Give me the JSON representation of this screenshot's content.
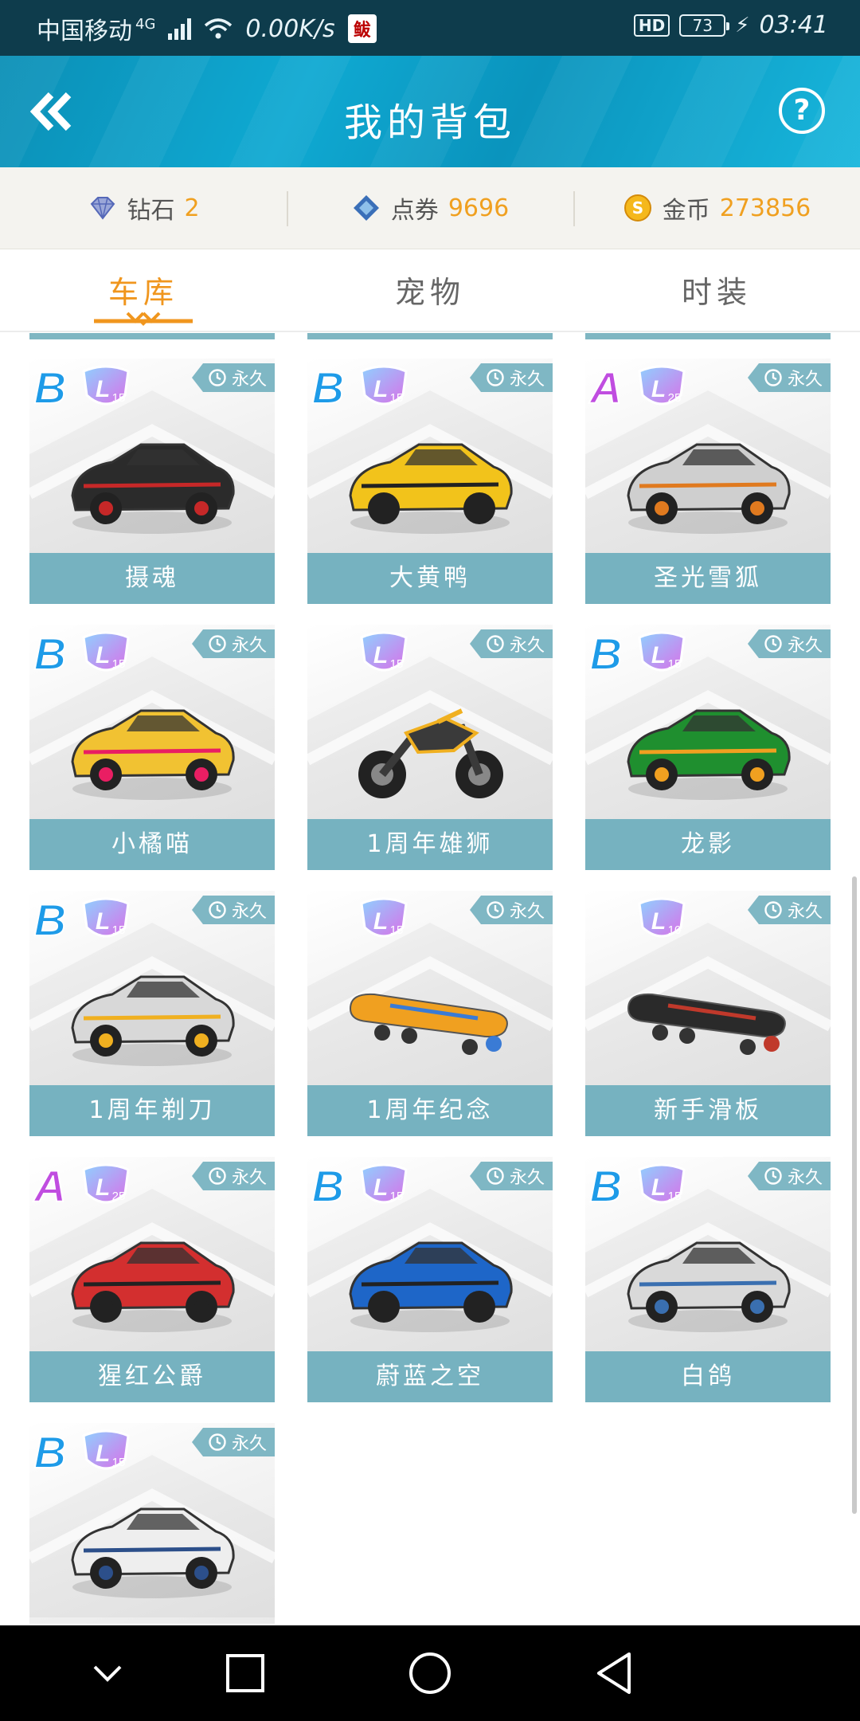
{
  "status_bar": {
    "carrier": "中国移动",
    "network": "4G",
    "speed": "0.00K/s",
    "hd": "HD",
    "battery": "73",
    "time": "03:41",
    "app_icon_text": "鲅"
  },
  "header": {
    "title": "我的背包",
    "back_icon": "double-chevron-left-icon",
    "help_icon": "?"
  },
  "currency": [
    {
      "label": "钻石",
      "value": "2",
      "icon": "diamond-icon"
    },
    {
      "label": "点券",
      "value": "9696",
      "icon": "voucher-icon"
    },
    {
      "label": "金币",
      "value": "273856",
      "icon": "coin-icon"
    }
  ],
  "tabs": [
    {
      "label": "车库",
      "active": true
    },
    {
      "label": "宠物",
      "active": false
    },
    {
      "label": "时装",
      "active": false
    }
  ],
  "permanent_label": "永久",
  "items": [
    {
      "name": "摄魂",
      "rank": "B",
      "level": "15",
      "vehicle": "car",
      "color": "#2b2b2b",
      "accent": "#c62828"
    },
    {
      "name": "大黄鸭",
      "rank": "B",
      "level": "15",
      "vehicle": "car",
      "color": "#f2c31b",
      "accent": "#222222"
    },
    {
      "name": "圣光雪狐",
      "rank": "A",
      "level": "25",
      "vehicle": "car",
      "color": "#cfcfcf",
      "accent": "#e07a1f"
    },
    {
      "name": "小橘喵",
      "rank": "B",
      "level": "15",
      "vehicle": "car",
      "color": "#f1c232",
      "accent": "#e91e63"
    },
    {
      "name": "1周年雄狮",
      "rank": "",
      "level": "15",
      "vehicle": "motorbike",
      "color": "#3a3a3a",
      "accent": "#f0b020"
    },
    {
      "name": "龙影",
      "rank": "B",
      "level": "15",
      "vehicle": "car",
      "color": "#1f8f2f",
      "accent": "#f0a020"
    },
    {
      "name": "1周年剃刀",
      "rank": "B",
      "level": "15",
      "vehicle": "car",
      "color": "#d8d8d8",
      "accent": "#f0b020"
    },
    {
      "name": "1周年纪念",
      "rank": "",
      "level": "15",
      "vehicle": "board",
      "color": "#f0a020",
      "accent": "#3a7bd5"
    },
    {
      "name": "新手滑板",
      "rank": "",
      "level": "10",
      "vehicle": "board",
      "color": "#2a2a2a",
      "accent": "#c0392b"
    },
    {
      "name": "猩红公爵",
      "rank": "A",
      "level": "25",
      "vehicle": "car",
      "color": "#d32f2f",
      "accent": "#222222"
    },
    {
      "name": "蔚蓝之空",
      "rank": "B",
      "level": "15",
      "vehicle": "car",
      "color": "#1e66c8",
      "accent": "#222222"
    },
    {
      "name": "白鸽",
      "rank": "B",
      "level": "15",
      "vehicle": "car",
      "color": "#d9d9d9",
      "accent": "#3a6fb0"
    },
    {
      "name": "",
      "rank": "B",
      "level": "15",
      "vehicle": "car",
      "color": "#eeeeee",
      "accent": "#2c4f8a"
    }
  ],
  "colors": {
    "accent_orange": "#f0961e",
    "label_teal": "#76b2c0",
    "header_blue": "#0fa9d2",
    "rank_b": "#1e9be8",
    "rank_a": "#c04de0"
  },
  "navbar": [
    "back-triangle-icon",
    "home-circle-icon",
    "recents-square-icon",
    "down-chevron-icon"
  ]
}
